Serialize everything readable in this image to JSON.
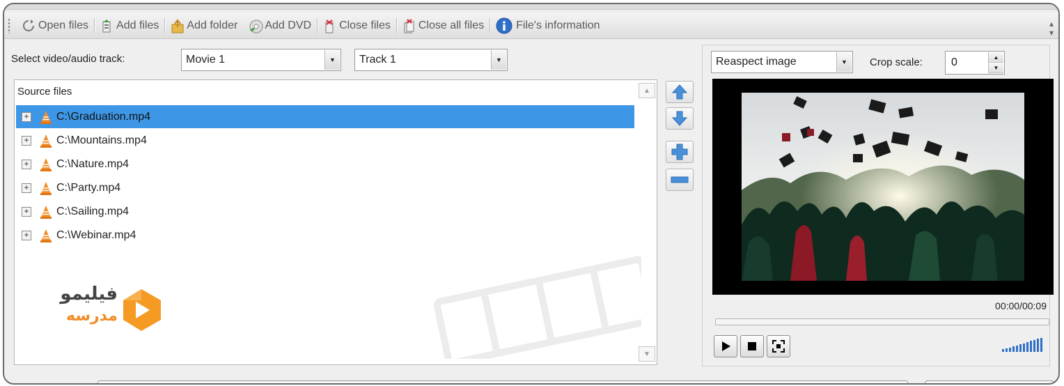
{
  "toolbar": {
    "open_files": "Open files",
    "add_files": "Add files",
    "add_folder": "Add folder",
    "add_dvd": "Add DVD",
    "close_files": "Close files",
    "close_all_files": "Close all files",
    "files_information": "File's information"
  },
  "track_select": {
    "label": "Select video/audio track:",
    "movie_value": "Movie 1",
    "track_value": "Track 1"
  },
  "source": {
    "header": "Source files",
    "files": [
      "C:\\Graduation.mp4",
      "C:\\Mountains.mp4",
      "C:\\Nature.mp4",
      "C:\\Party.mp4",
      "C:\\Sailing.mp4",
      "C:\\Webinar.mp4"
    ],
    "selected_index": 0
  },
  "watermark": {
    "line1": "فیلیمو",
    "line2": "مدرسه"
  },
  "preview": {
    "aspect_mode": "Reaspect image",
    "crop_label": "Crop scale:",
    "crop_value": "0",
    "time": "00:00/00:09",
    "progress": 0
  },
  "colors": {
    "selection": "#3d97e6",
    "accent_orange": "#f28c28",
    "arrow_blue": "#4a90d9"
  },
  "icons": {
    "open": "open-files-icon",
    "add": "add-files-icon",
    "folder": "add-folder-icon",
    "dvd": "add-dvd-icon",
    "close": "close-files-icon",
    "info": "info-icon",
    "file": "vlc-cone-icon"
  }
}
